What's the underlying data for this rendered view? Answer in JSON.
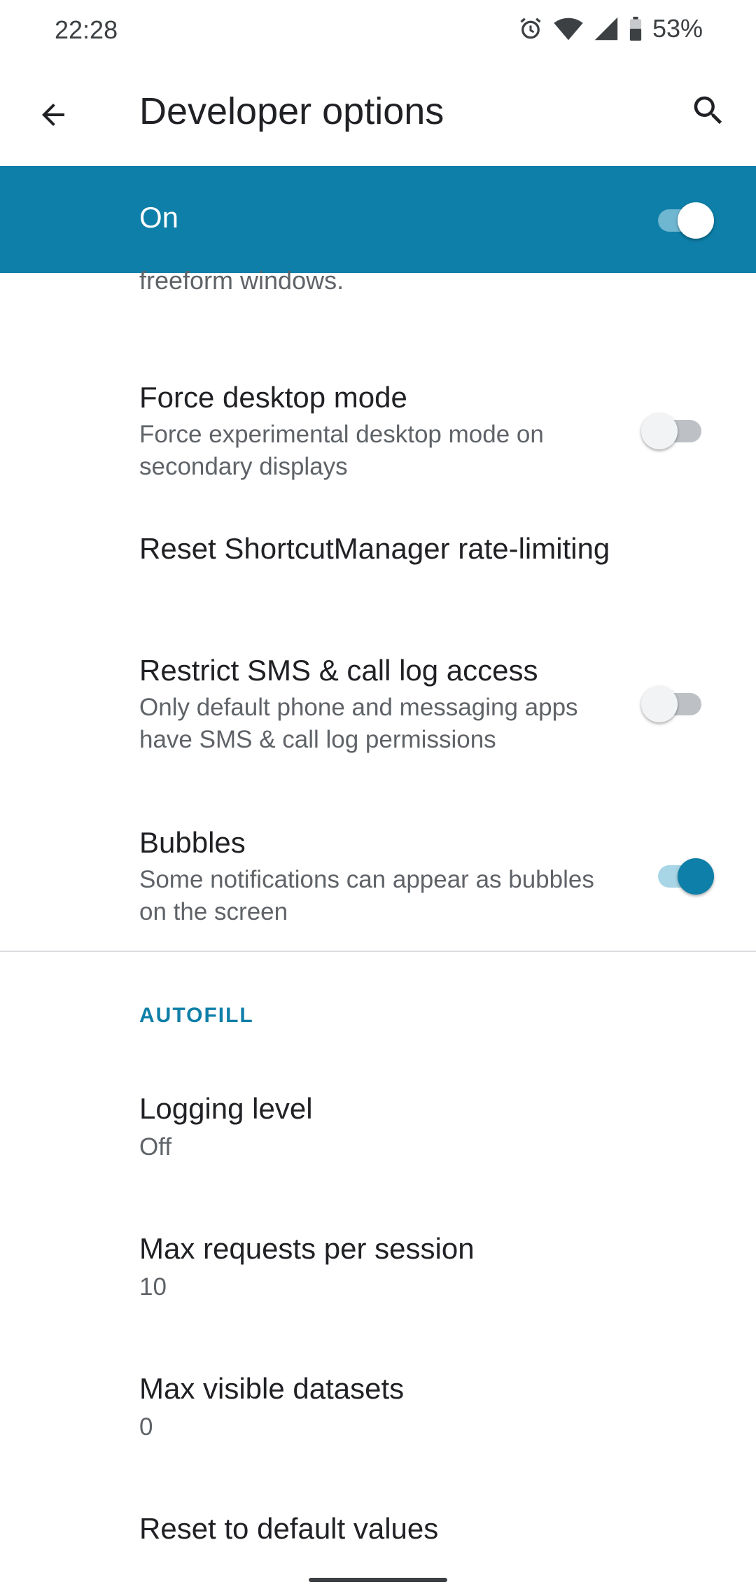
{
  "status_bar": {
    "time": "22:28",
    "battery_percent": "53%",
    "icons": [
      "alarm-icon",
      "wifi-icon",
      "signal-icon",
      "battery-icon"
    ]
  },
  "app_bar": {
    "title": "Developer options",
    "back_icon": "arrow-left-icon",
    "search_icon": "search-icon"
  },
  "master_switch": {
    "label": "On",
    "checked": true
  },
  "list": {
    "cut_off_summary": "freeform windows.",
    "items": [
      {
        "title": "Force desktop mode",
        "summary": "Force experimental desktop mode on secondary displays",
        "toggle": false
      },
      {
        "title": "Reset ShortcutManager rate-limiting"
      },
      {
        "title": "Restrict SMS & call log access",
        "summary": "Only default phone and messaging apps have SMS & call log permissions",
        "toggle": false
      },
      {
        "title": "Bubbles",
        "summary": "Some notifications can appear as bubbles on the screen",
        "toggle": true
      }
    ]
  },
  "autofill": {
    "header": "AUTOFILL",
    "items": [
      {
        "title": "Logging level",
        "value": "Off"
      },
      {
        "title": "Max requests per session",
        "value": "10"
      },
      {
        "title": "Max visible datasets",
        "value": "0"
      },
      {
        "title": "Reset to default values"
      }
    ]
  },
  "colors": {
    "accent": "#0e7fa8",
    "text_primary": "#202124",
    "text_secondary": "#5f6368"
  }
}
